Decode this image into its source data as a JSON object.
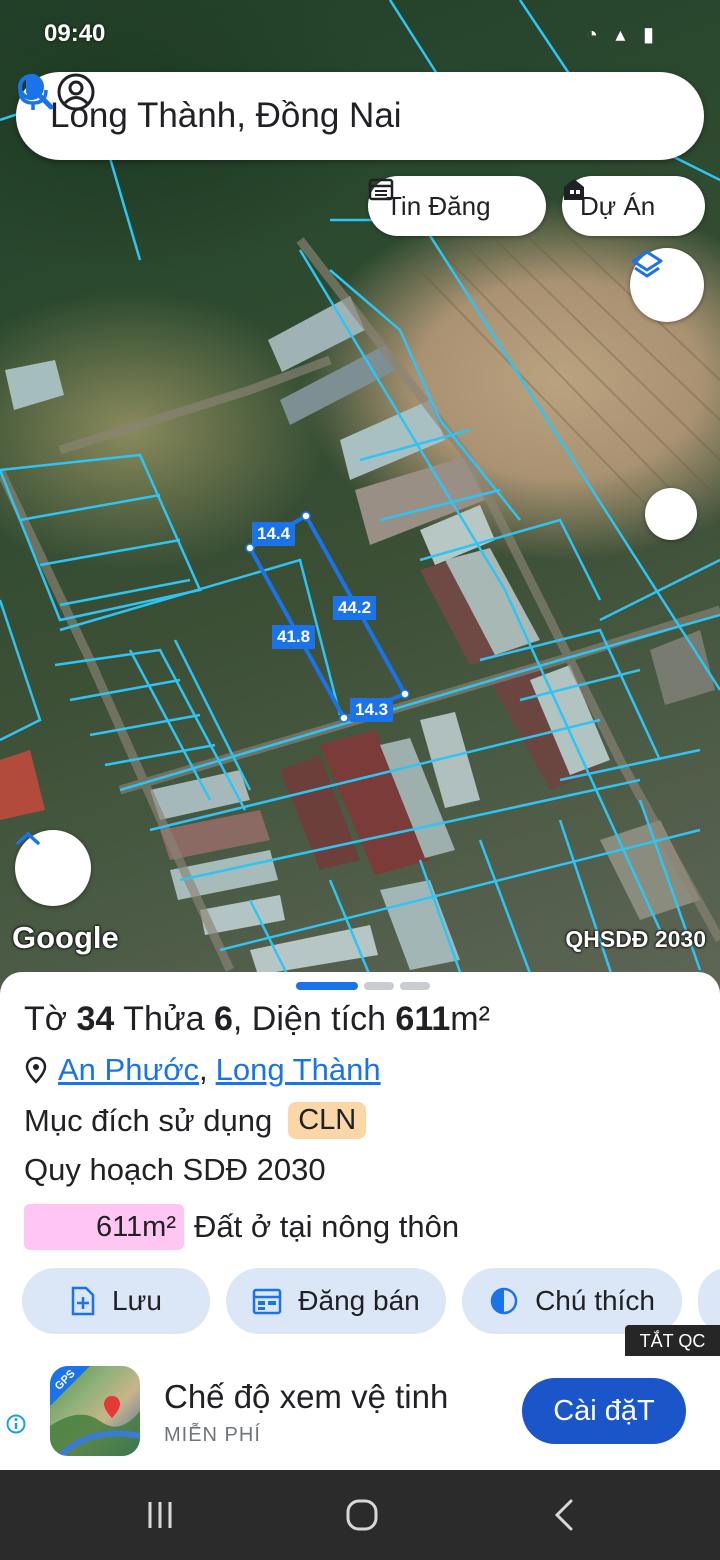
{
  "status_bar": {
    "time": "09:40"
  },
  "search": {
    "query": "Long Thành, Đồng Nai"
  },
  "chips": {
    "news": "Tin Đăng",
    "project": "Dự Án"
  },
  "map": {
    "attribution": "Google",
    "layer_label": "QHSDĐ 2030",
    "dimensions": {
      "top": "14.4",
      "right": "44.2",
      "left": "41.8",
      "bottom": "14.3"
    }
  },
  "parcel": {
    "sheet_prefix": "Tờ ",
    "sheet_no": "34",
    "plot_prefix": " Thửa ",
    "plot_no": "6",
    "area_prefix": ", Diện tích ",
    "area": "611",
    "area_unit": "m²",
    "ward": "An Phước",
    "separator": ",",
    "district": "Long Thành",
    "purpose_label": "Mục đích sử dụng",
    "purpose_code": "CLN",
    "plan_label": "Quy hoạch SDĐ 2030",
    "plan_area": "611m²",
    "plan_land_type": "Đất ở tại nông thôn",
    "plan_color": "#ffc6f3"
  },
  "actions": {
    "save": "Lưu",
    "post": "Đăng bán",
    "legend": "Chú thích"
  },
  "ad": {
    "close_label": "TẮT QC",
    "title": "Chế độ xem vệ tinh",
    "subtitle": "MIỄN PHÍ",
    "cta": "Cài đặT",
    "logo_badge": "GPS"
  },
  "colors": {
    "accent": "#1a73e8",
    "parcel_lines": "#2ec5f5",
    "cta": "#1a56c9"
  }
}
